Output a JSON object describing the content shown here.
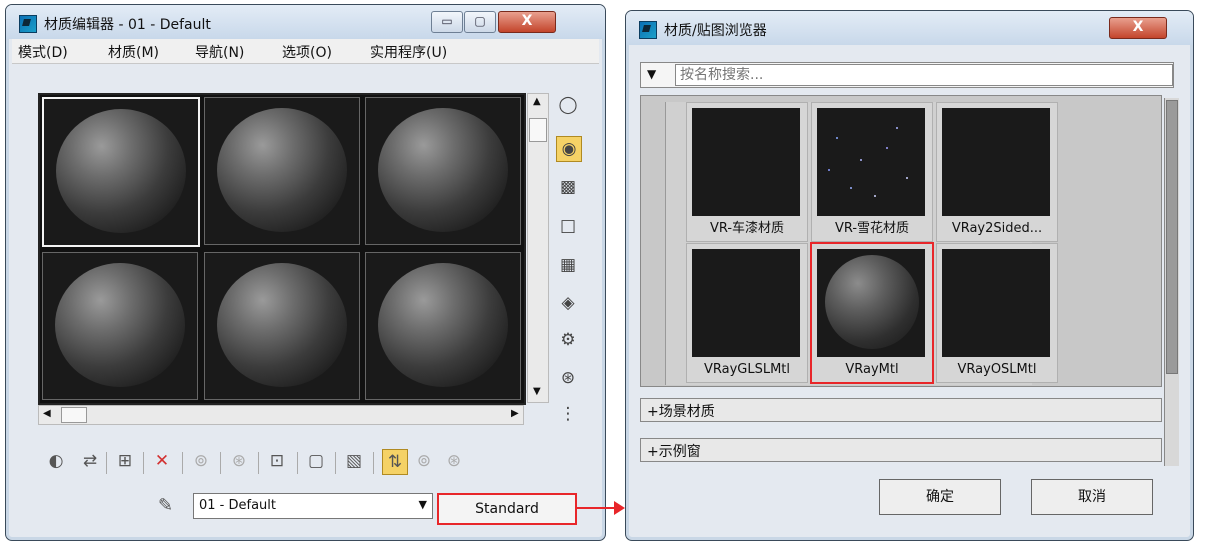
{
  "material_editor": {
    "title": "材质编辑器 - 01 - Default",
    "menu": [
      "模式(D)",
      "材质(M)",
      "导航(N)",
      "选项(O)",
      "实用程序(U)"
    ],
    "material_name": "01 - Default",
    "type_button": "Standard",
    "min_glyph": "▭",
    "max_glyph": "▢",
    "close_glyph": "X"
  },
  "browser": {
    "title": "材质/贴图浏览器",
    "search_placeholder": "按名称搜索...",
    "materials": [
      "VR-车漆材质",
      "VR-雪花材质",
      "VRay2Sided...",
      "VRayGLSLMtl",
      "VRayMtl",
      "VRayOSLMtl"
    ],
    "selected_material": "VRayMtl",
    "sections": [
      "+场景材质",
      "+示例窗"
    ],
    "ok_button": "确定",
    "cancel_button": "取消",
    "close_glyph": "X"
  },
  "colors": {
    "highlight": "#e8262a",
    "active_tool": "#f5d266"
  }
}
